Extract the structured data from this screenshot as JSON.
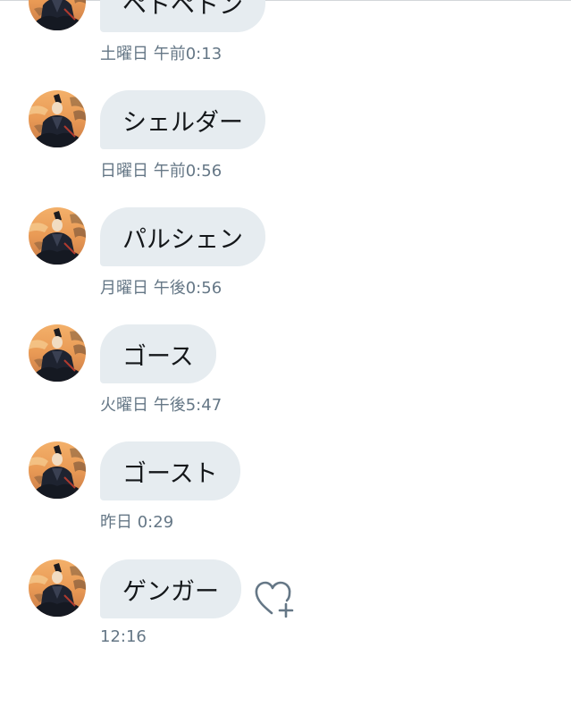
{
  "messages": [
    {
      "text": "ペトペトン",
      "time": "土曜日 午前0:13"
    },
    {
      "text": "シェルダー",
      "time": "日曜日 午前0:56"
    },
    {
      "text": "パルシェン",
      "time": "月曜日 午後0:56"
    },
    {
      "text": "ゴース",
      "time": "火曜日 午後5:47"
    },
    {
      "text": "ゴースト",
      "time": "昨日 0:29"
    },
    {
      "text": "ゲンガー",
      "time": "12:16"
    }
  ],
  "icons": {
    "avatar": "avatar-portrait",
    "like": "heart-plus-icon"
  },
  "colors": {
    "bubble": "#e6ecf0",
    "timestamp": "#657786",
    "text": "#14171a",
    "heart": "#657786"
  }
}
